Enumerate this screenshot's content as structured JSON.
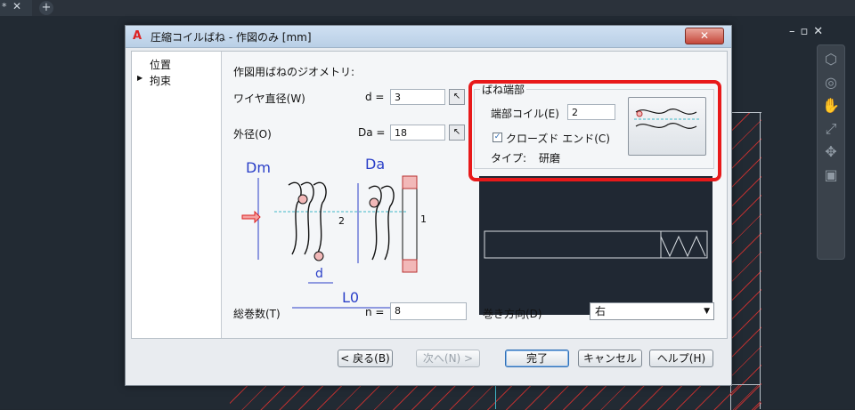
{
  "tabs": {
    "current_star": "*",
    "close": "✕",
    "new": "+"
  },
  "viewport": {
    "controls": "–▫✕"
  },
  "nav_icons": [
    "cube-icon",
    "steering-wheel-icon",
    "pan-hand-icon",
    "zoom-icon",
    "orbit-icon",
    "showmotion-icon"
  ],
  "dialog": {
    "logo": "A",
    "title": "圧縮コイルばね - 作図のみ [mm]",
    "close_label": "✕",
    "nav": {
      "items": [
        "位置",
        "拘束"
      ],
      "selected_marker": "▶"
    },
    "geometry_title": "作図用ばねのジオメトリ:",
    "wire_label": "ワイヤ直径(W)",
    "wire_symbol": "d =",
    "wire_value": "3",
    "outer_label": "外径(O)",
    "outer_symbol": "Da =",
    "outer_value": "18",
    "end_group": {
      "title": "ばね端部",
      "end_coil_label": "端部コイル(E)",
      "end_coil_value": "2",
      "closed_end_label": "クローズド エンド(C)",
      "closed_end_checked": "✓",
      "type_label": "タイプ:",
      "type_value": "研磨"
    },
    "diagram": {
      "dm": "Dm",
      "da": "Da",
      "d": "d",
      "lo": "L0",
      "num2": "2",
      "num1": "1"
    },
    "turns_label": "総巻数(T)",
    "turns_symbol": "n =",
    "turns_value": "8",
    "direction_label": "巻き方向(D)",
    "direction_value": "右",
    "buttons": {
      "back": "< 戻る(B)",
      "next": "次へ(N) >",
      "finish": "完了",
      "cancel": "キャンセル",
      "help": "ヘルプ(H)"
    }
  },
  "colors": {
    "highlight": "#e8191a",
    "dimension": "#2a3fc8",
    "hatch": "#b83030"
  }
}
